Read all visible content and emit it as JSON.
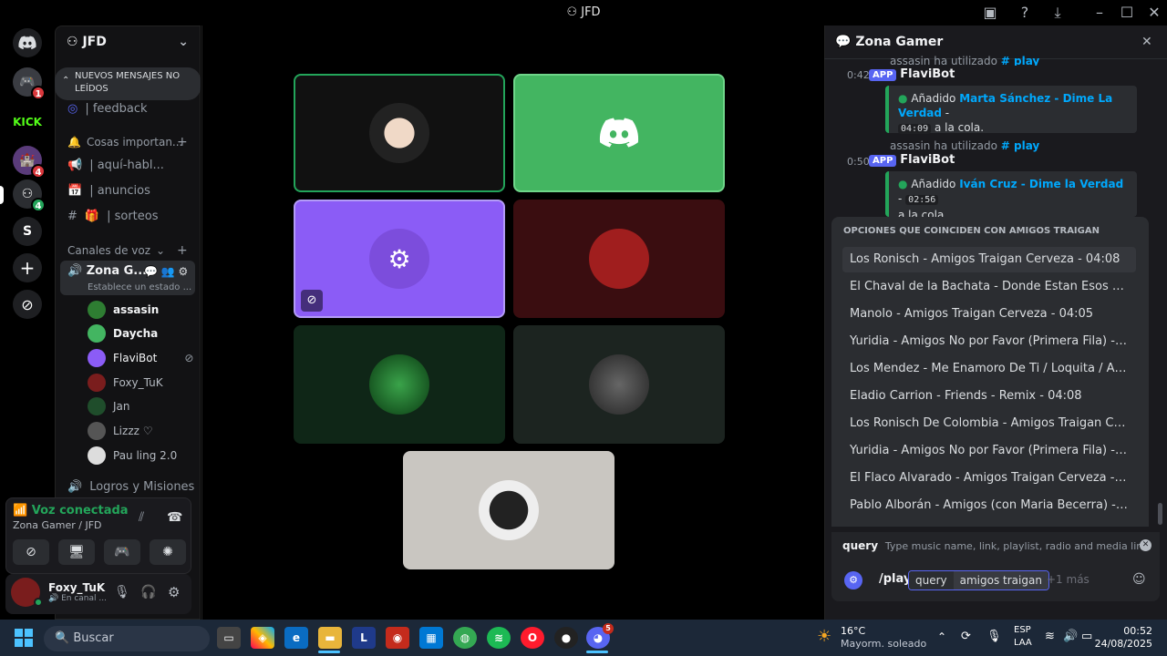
{
  "window": {
    "title": "JFD"
  },
  "servers": {
    "badges": [
      "1",
      "4",
      "4"
    ],
    "letter": "S"
  },
  "sidebar": {
    "server_name": "JFD",
    "new_messages": "NUEVOS MENSAJES NO LEÍDOS",
    "channels": [
      {
        "name": "| feedback"
      },
      {
        "category": "Cosas importan..."
      },
      {
        "name": "| aquí-habl..."
      },
      {
        "name": "| anuncios"
      },
      {
        "name": "| sorteos"
      }
    ],
    "voice_category": "Canales de voz",
    "voice_channel": "Zona G...",
    "voice_status": "Establece un estado ...",
    "voice_users": [
      "assasin",
      "Daycha",
      "FlaviBot",
      "Foxy_TuK",
      "Jan",
      "Lizzz ♡",
      "Pau ling 2.0"
    ],
    "logros": "Logros y Misiones"
  },
  "voice_panel": {
    "status": "Voz conectada",
    "location": "Zona Gamer / JFD"
  },
  "user_panel": {
    "name": "Foxy_TuK",
    "status": "En canal ..."
  },
  "colors": {
    "accent": "#5865f2",
    "green": "#23a55a",
    "tile_green": "#43b561",
    "tile_purple": "#8b5cf6",
    "tile_red": "#3a0d10"
  },
  "chat": {
    "channel": "Zona Gamer",
    "top_partial": "assasin ha utilizado",
    "top_partial_cmd": "play",
    "messages": [
      {
        "time": "0:42",
        "author": "FlaviBot",
        "tag": "APP",
        "embed_prefix": "Añadido",
        "song": "Marta Sánchez - Dime La Verdad",
        "sep": "-",
        "duration": "04:09",
        "suffix": "a la cola."
      },
      {
        "reply_user": "assasin ha utilizado",
        "reply_cmd": "play",
        "time": "0:50",
        "author": "FlaviBot",
        "tag": "APP",
        "embed_prefix": "Añadido",
        "song": "Iván Cruz - Dime la Verdad",
        "sep": "-",
        "duration": "02:56",
        "suffix": "a la cola."
      }
    ],
    "options_header": "OPCIONES QUE COINCIDEN CON AMIGOS TRAIGAN",
    "options": [
      "Los Ronisch - Amigos Traigan Cerveza - 04:08",
      "El Chaval de la Bachata - Donde Estan Esos Amigos -...",
      "Manolo - Amigos Traigan Cerveza - 04:05",
      "Yuridia - Amigos No por Favor (Primera Fila) - En Viv...",
      "Los Mendez - Me Enamoro De Ti / Loquita / Amanec...",
      "Eladio Carrion - Friends - Remix - 04:08",
      "Los Ronisch De Colombia - Amigos Traigan Cerveza -...",
      "Yuridia - Amigos No por Favor (Primera Fila) - En Viv...",
      "El Flaco Alvarado - Amigos Traigan Cerveza - 03:57",
      "Pablo Alborán - Amigos (con Maria Becerra) - 03:53"
    ],
    "query_label": "query",
    "query_hint": "Type music name, link, playlist, radio and media link.",
    "command": "/play",
    "query_chip": "query",
    "query_value": "amigos traigan",
    "more": "+1 más"
  },
  "taskbar": {
    "search_placeholder": "Buscar",
    "weather_temp": "16°C",
    "weather_desc": "Mayorm. soleado",
    "lang": "ESP",
    "lang2": "LAA",
    "time": "00:52",
    "date": "24/08/2025",
    "discord_badge": "5"
  }
}
